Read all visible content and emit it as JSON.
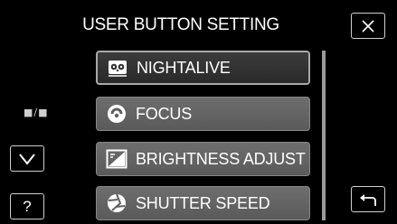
{
  "header": {
    "title": "USER BUTTON SETTING"
  },
  "mode_indicator": "■/■",
  "help_label": "?",
  "menu": {
    "items": [
      {
        "label": "NIGHTALIVE",
        "icon": "owl-icon",
        "selected": true
      },
      {
        "label": "FOCUS",
        "icon": "focus-icon",
        "selected": false
      },
      {
        "label": "BRIGHTNESS ADJUST",
        "icon": "brightness-icon",
        "selected": false
      },
      {
        "label": "SHUTTER SPEED",
        "icon": "shutter-icon",
        "selected": false
      }
    ]
  }
}
